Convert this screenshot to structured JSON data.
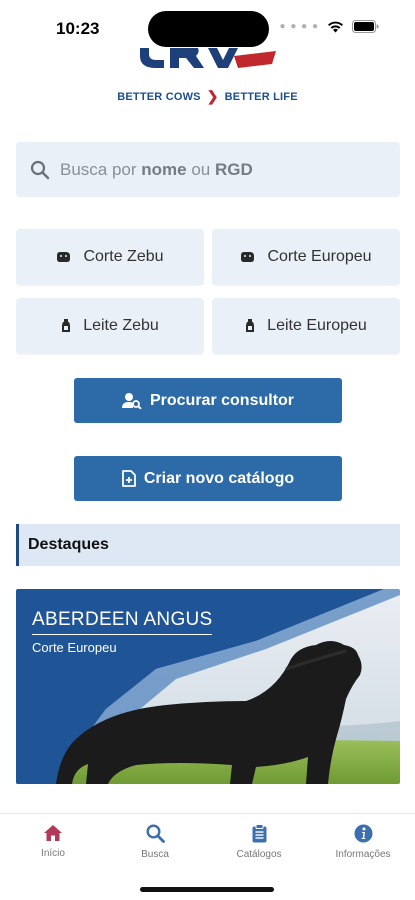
{
  "status_bar": {
    "time": "10:23"
  },
  "logo": {
    "tagline_left": "BETTER COWS",
    "tagline_right": "BETTER LIFE"
  },
  "search": {
    "prefix": "Busca por ",
    "bold1": "nome",
    "middle": " ou ",
    "bold2": "RGD"
  },
  "categories": [
    {
      "label": "Corte Zebu",
      "icon": "cow-icon"
    },
    {
      "label": "Corte Europeu",
      "icon": "cow-icon"
    },
    {
      "label": "Leite Zebu",
      "icon": "milk-bottle-icon"
    },
    {
      "label": "Leite Europeu",
      "icon": "milk-bottle-icon"
    }
  ],
  "actions": {
    "consultant": {
      "label": "Procurar consultor",
      "icon": "user-search-icon"
    },
    "catalog": {
      "label": "Criar novo catálogo",
      "icon": "file-plus-icon"
    }
  },
  "highlights": {
    "title": "Destaques",
    "banner": {
      "title": "ABERDEEN ANGUS",
      "subtitle": "Corte Europeu"
    }
  },
  "tabbar": [
    {
      "label": "Início",
      "icon": "home-icon",
      "active": true
    },
    {
      "label": "Busca",
      "icon": "search-icon",
      "active": false
    },
    {
      "label": "Catálogos",
      "icon": "clipboard-icon",
      "active": false
    },
    {
      "label": "Informações",
      "icon": "info-icon",
      "active": false
    }
  ],
  "colors": {
    "brand_blue": "#2c6aa8",
    "brand_red": "#c0282d",
    "tab_active": "#b2395a",
    "tab_inactive": "#3b6fae"
  }
}
